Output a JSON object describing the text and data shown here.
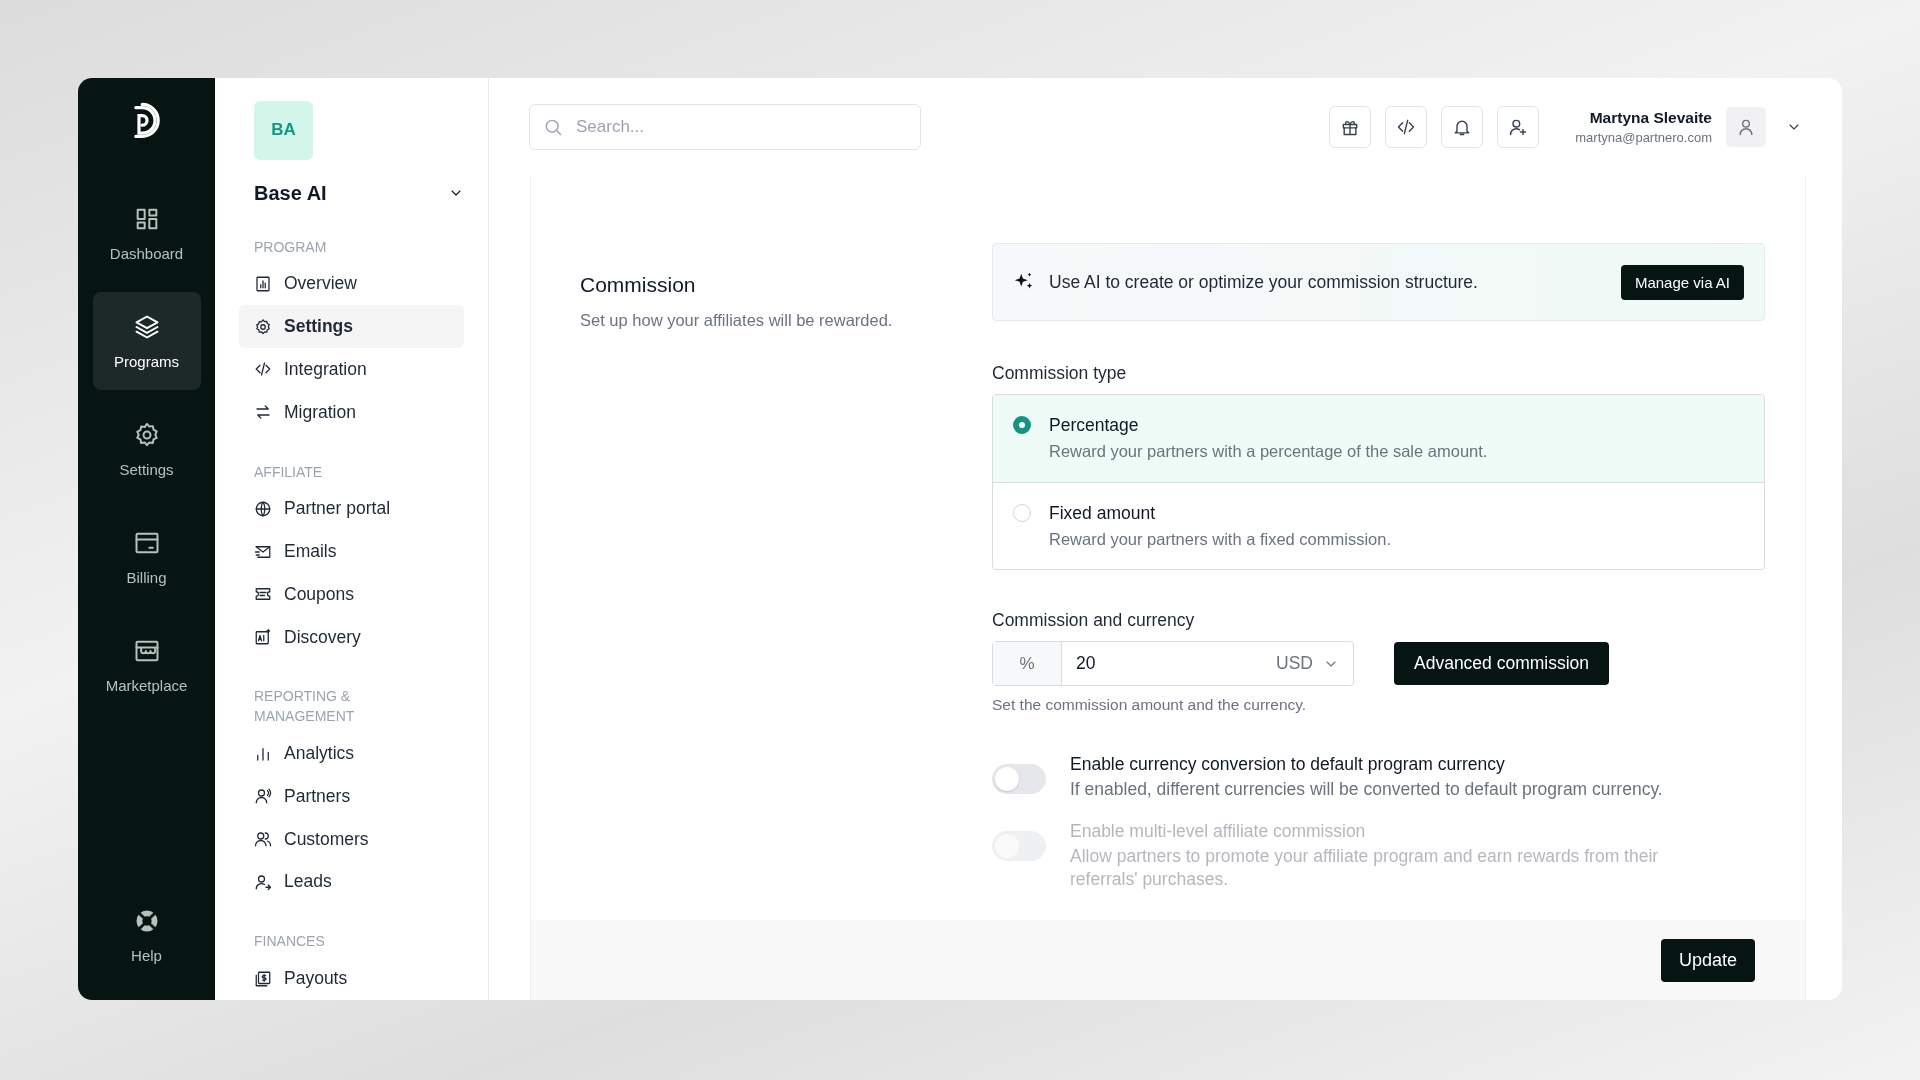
{
  "rail": {
    "items": [
      {
        "label": "Dashboard",
        "kind": "grid",
        "selected": false
      },
      {
        "label": "Programs",
        "kind": "layers",
        "selected": true
      },
      {
        "label": "Settings",
        "kind": "gear",
        "selected": false
      },
      {
        "label": "Billing",
        "kind": "card",
        "selected": false
      },
      {
        "label": "Marketplace",
        "kind": "store",
        "selected": false
      }
    ],
    "help": {
      "label": "Help",
      "kind": "lifebuoy",
      "selected": false
    }
  },
  "program": {
    "initials": "BA",
    "name": "Base AI"
  },
  "nav": {
    "sections": [
      {
        "title": "PROGRAM",
        "items": [
          {
            "label": "Overview",
            "kind": "report",
            "selected": false
          },
          {
            "label": "Settings",
            "kind": "gear",
            "selected": true
          },
          {
            "label": "Integration",
            "kind": "code",
            "selected": false
          },
          {
            "label": "Migration",
            "kind": "swap",
            "selected": false
          }
        ]
      },
      {
        "title": "AFFILIATE",
        "items": [
          {
            "label": "Partner portal",
            "kind": "globe",
            "selected": false
          },
          {
            "label": "Emails",
            "kind": "mail",
            "selected": false
          },
          {
            "label": "Coupons",
            "kind": "ticket",
            "selected": false
          },
          {
            "label": "Discovery",
            "kind": "ai",
            "selected": false
          }
        ]
      },
      {
        "title": "REPORTING & MANAGEMENT",
        "items": [
          {
            "label": "Analytics",
            "kind": "bars",
            "selected": false
          },
          {
            "label": "Partners",
            "kind": "person-wave",
            "selected": false
          },
          {
            "label": "Customers",
            "kind": "people",
            "selected": false
          },
          {
            "label": "Leads",
            "kind": "person-arrow",
            "selected": false
          }
        ]
      },
      {
        "title": "FINANCES",
        "items": [
          {
            "label": "Payouts",
            "kind": "money",
            "selected": false
          }
        ]
      }
    ]
  },
  "topbar": {
    "search": {
      "placeholder": "Search..."
    },
    "actions": [
      {
        "kind": "gift"
      },
      {
        "kind": "code"
      },
      {
        "kind": "bell"
      },
      {
        "kind": "user-plus"
      }
    ],
    "user": {
      "name": "Martyna Slevaite",
      "email": "martyna@partnero.com"
    }
  },
  "commission": {
    "title": "Commission",
    "subtitle": "Set up how your affiliates will be rewarded.",
    "ai_banner": {
      "text": "Use AI to create or optimize your commission structure.",
      "button": "Manage via AI"
    },
    "type_label": "Commission type",
    "options": [
      {
        "title": "Percentage",
        "description": "Reward your partners with a percentage of the sale amount.",
        "selected": true
      },
      {
        "title": "Fixed amount",
        "description": "Reward your partners with a fixed commission.",
        "selected": false
      }
    ],
    "amount_label": "Commission and currency",
    "unit": "%",
    "value": "20",
    "currency": "USD",
    "advanced_button": "Advanced commission",
    "hint": "Set the commission amount and the currency.",
    "toggles": [
      {
        "title": "Enable currency conversion to default program currency",
        "description": "If enabled, different currencies will be converted to default program currency.",
        "on": false,
        "disabled": false
      },
      {
        "title": "Enable multi-level affiliate commission",
        "description": "Allow partners to promote your affiliate program and earn rewards from their referrals' purchases.",
        "on": false,
        "disabled": true
      }
    ]
  },
  "footer": {
    "button": "Update"
  }
}
